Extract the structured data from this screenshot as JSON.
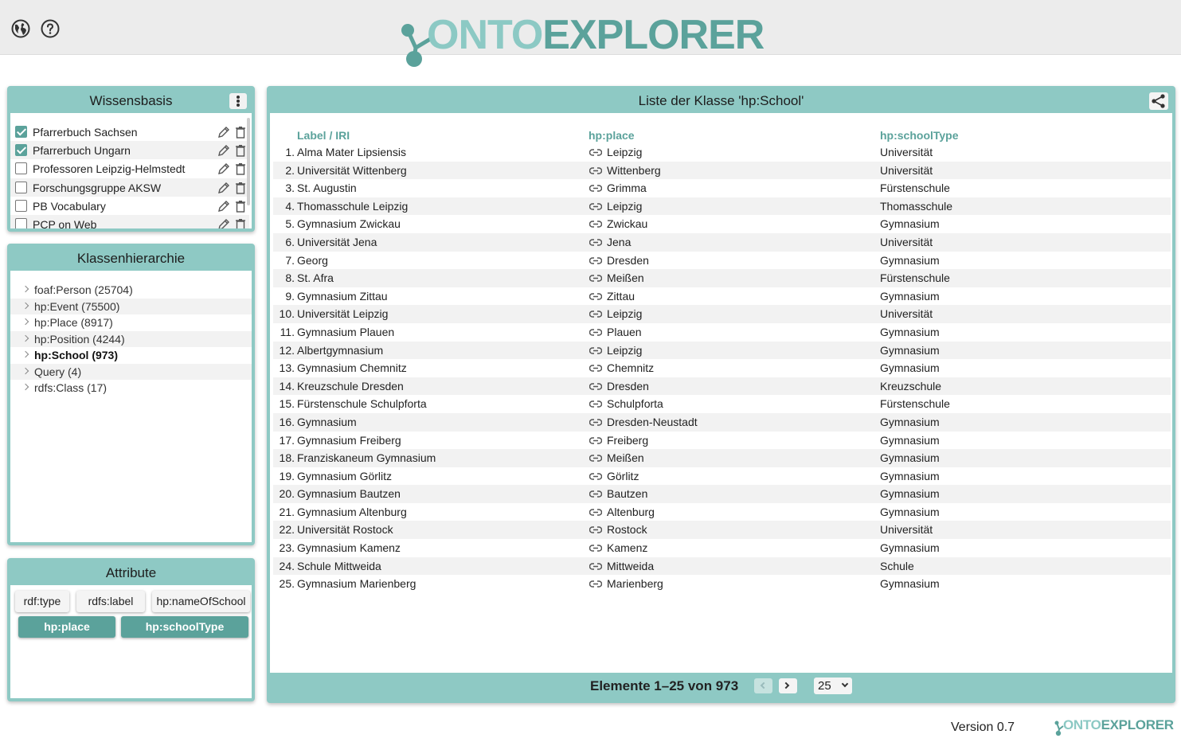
{
  "header": {
    "logo_part1": "ONTO",
    "logo_part2": "EXPLORER"
  },
  "knowledge_base": {
    "title": "Wissensbasis",
    "items": [
      {
        "label": "Pfarrerbuch Sachsen",
        "checked": true
      },
      {
        "label": "Pfarrerbuch Ungarn",
        "checked": true
      },
      {
        "label": "Professoren Leipzig-Helmstedt",
        "checked": false
      },
      {
        "label": "Forschungsgruppe AKSW",
        "checked": false
      },
      {
        "label": "PB Vocabulary",
        "checked": false
      },
      {
        "label": "PCP on Web",
        "checked": false
      }
    ]
  },
  "hierarchy": {
    "title": "Klassenhierarchie",
    "items": [
      "foaf:Person (25704)",
      "hp:Event (75500)",
      "hp:Place (8917)",
      "hp:Position (4244)",
      "hp:School (973)",
      "Query (4)",
      "rdfs:Class (17)"
    ],
    "selected_index": 4
  },
  "attributes": {
    "title": "Attribute",
    "chips": [
      {
        "label": "rdf:type",
        "active": false
      },
      {
        "label": "rdfs:label",
        "active": false
      },
      {
        "label": "hp:nameOfSchool",
        "active": false
      },
      {
        "label": "hp:place",
        "active": true
      },
      {
        "label": "hp:schoolType",
        "active": true
      }
    ]
  },
  "list": {
    "title": "Liste der Klasse 'hp:School'",
    "columns": [
      "Label / IRI",
      "hp:place",
      "hp:schoolType"
    ],
    "rows": [
      {
        "n": "1.",
        "label": "Alma Mater Lipsiensis",
        "place": "Leipzig",
        "type": "Universität"
      },
      {
        "n": "2.",
        "label": "Universität Wittenberg",
        "place": "Wittenberg",
        "type": "Universität"
      },
      {
        "n": "3.",
        "label": "St. Augustin",
        "place": "Grimma",
        "type": "Fürstenschule"
      },
      {
        "n": "4.",
        "label": "Thomasschule Leipzig",
        "place": "Leipzig",
        "type": "Thomasschule"
      },
      {
        "n": "5.",
        "label": "Gymnasium Zwickau",
        "place": "Zwickau",
        "type": "Gymnasium"
      },
      {
        "n": "6.",
        "label": "Universität Jena",
        "place": "Jena",
        "type": "Universität"
      },
      {
        "n": "7.",
        "label": "Georg",
        "place": "Dresden",
        "type": "Gymnasium"
      },
      {
        "n": "8.",
        "label": "St. Afra",
        "place": "Meißen",
        "type": "Fürstenschule"
      },
      {
        "n": "9.",
        "label": "Gymnasium Zittau",
        "place": "Zittau",
        "type": "Gymnasium"
      },
      {
        "n": "10.",
        "label": "Universität Leipzig",
        "place": "Leipzig",
        "type": "Universität"
      },
      {
        "n": "11.",
        "label": "Gymnasium Plauen",
        "place": "Plauen",
        "type": "Gymnasium"
      },
      {
        "n": "12.",
        "label": "Albertgymnasium",
        "place": "Leipzig",
        "type": "Gymnasium"
      },
      {
        "n": "13.",
        "label": "Gymnasium Chemnitz",
        "place": "Chemnitz",
        "type": "Gymnasium"
      },
      {
        "n": "14.",
        "label": "Kreuzschule Dresden",
        "place": "Dresden",
        "type": "Kreuzschule"
      },
      {
        "n": "15.",
        "label": "Fürstenschule Schulpforta",
        "place": "Schulpforta",
        "type": "Fürstenschule"
      },
      {
        "n": "16.",
        "label": "Gymnasium",
        "place": "Dresden-Neustadt",
        "type": "Gymnasium"
      },
      {
        "n": "17.",
        "label": "Gymnasium Freiberg",
        "place": "Freiberg",
        "type": "Gymnasium"
      },
      {
        "n": "18.",
        "label": "Franziskaneum Gymnasium",
        "place": "Meißen",
        "type": "Gymnasium"
      },
      {
        "n": "19.",
        "label": "Gymnasium Görlitz",
        "place": "Görlitz",
        "type": "Gymnasium"
      },
      {
        "n": "20.",
        "label": "Gymnasium Bautzen",
        "place": "Bautzen",
        "type": "Gymnasium"
      },
      {
        "n": "21.",
        "label": "Gymnasium Altenburg",
        "place": "Altenburg",
        "type": "Gymnasium"
      },
      {
        "n": "22.",
        "label": "Universität Rostock",
        "place": "Rostock",
        "type": "Universität"
      },
      {
        "n": "23.",
        "label": "Gymnasium Kamenz",
        "place": "Kamenz",
        "type": "Gymnasium"
      },
      {
        "n": "24.",
        "label": "Schule Mittweida",
        "place": "Mittweida",
        "type": "Schule"
      },
      {
        "n": "25.",
        "label": "Gymnasium Marienberg",
        "place": "Marienberg",
        "type": "Gymnasium"
      }
    ],
    "pagination_text": "Elemente 1–25 von 973",
    "page_size": "25"
  },
  "footer": {
    "version": "Version 0.7",
    "logo_part1": "ONTO",
    "logo_part2": "EXPLORER"
  },
  "colors": {
    "accent_light": "#8ec9c4",
    "accent_dark": "#5ba29b"
  },
  "icons": [
    "globe-icon",
    "help-icon",
    "kebab-menu-icon",
    "edit-icon",
    "trash-icon",
    "share-icon",
    "link-icon",
    "chevron-right-icon",
    "chevron-left-icon",
    "chevron-down-icon"
  ]
}
